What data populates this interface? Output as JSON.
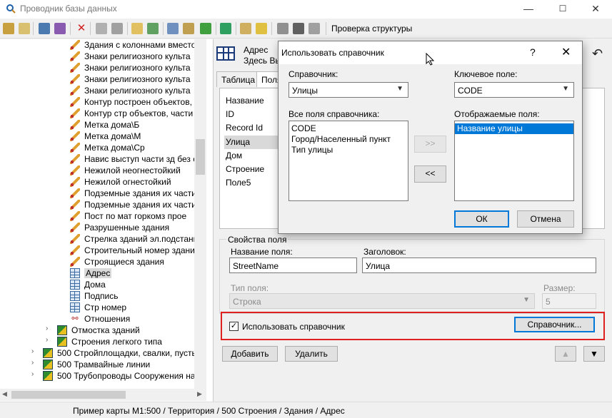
{
  "window": {
    "title": "Проводник базы данных",
    "min": "—",
    "max": "☐",
    "close": "✕"
  },
  "toolbar": {
    "check_structure": "Проверка структуры"
  },
  "tree": {
    "items": [
      {
        "label": "Здания с колоннами вместо",
        "icon": "pencil-icon",
        "indent": 2
      },
      {
        "label": "Знаки религиозного культа",
        "icon": "pencil-icon",
        "indent": 2
      },
      {
        "label": "Знаки религиозного культа",
        "icon": "pencil-icon",
        "indent": 2
      },
      {
        "label": "Знаки религиозного культа",
        "icon": "pencil-icon",
        "indent": 2
      },
      {
        "label": "Знаки религиозного культа",
        "icon": "pencil-icon",
        "indent": 2
      },
      {
        "label": "Контур построен объектов,",
        "icon": "pencil-icon",
        "indent": 2
      },
      {
        "label": "Контур стр объектов, части",
        "icon": "pencil-icon",
        "indent": 2
      },
      {
        "label": "Метка дома\\Б",
        "icon": "pencil-icon",
        "indent": 2
      },
      {
        "label": "Метка дома\\М",
        "icon": "pencil-icon",
        "indent": 2
      },
      {
        "label": "Метка дома\\Ср",
        "icon": "pencil-icon",
        "indent": 2
      },
      {
        "label": "Навис выступ части зд без с",
        "icon": "pencil-icon",
        "indent": 2
      },
      {
        "label": "Нежилой неогнестойкий",
        "icon": "pencil-icon",
        "indent": 2
      },
      {
        "label": "Нежилой огнестойкий",
        "icon": "pencil-icon",
        "indent": 2
      },
      {
        "label": "Подземные здания их части",
        "icon": "pencil-icon",
        "indent": 2
      },
      {
        "label": "Подземные здания их части",
        "icon": "pencil-icon",
        "indent": 2
      },
      {
        "label": "Пост по мат горкомз прое",
        "icon": "pencil-icon",
        "indent": 2
      },
      {
        "label": "Разрушенные здания",
        "icon": "pencil-icon",
        "indent": 2
      },
      {
        "label": "Стрелка зданий эл.подстанц",
        "icon": "pencil-icon",
        "indent": 2
      },
      {
        "label": "Строительный номер здани",
        "icon": "pencil-icon",
        "indent": 2
      },
      {
        "label": "Строящиеся здания",
        "icon": "pencil-icon",
        "indent": 2
      },
      {
        "label": "Адрес",
        "icon": "table-icon",
        "indent": 2,
        "selected": true
      },
      {
        "label": "Дома",
        "icon": "table-icon",
        "indent": 2
      },
      {
        "label": "Подпись",
        "icon": "table-icon",
        "indent": 2
      },
      {
        "label": "Стр номер",
        "icon": "table-icon",
        "indent": 2
      },
      {
        "label": "Отношения",
        "icon": "relation-icon",
        "indent": 2
      },
      {
        "label": "Отмостка зданий",
        "icon": "layer-icon",
        "indent": 1,
        "arrow": "›"
      },
      {
        "label": "Строения легкого типа",
        "icon": "layer-icon",
        "indent": 1,
        "arrow": "›"
      },
      {
        "label": "500 Стройплощадки, свалки, пусть",
        "icon": "layer-icon",
        "indent": 0,
        "arrow": "›"
      },
      {
        "label": "500 Трамвайные линии",
        "icon": "layer-icon",
        "indent": 0,
        "arrow": "›"
      },
      {
        "label": "500 Трубопроводы Сооружения на",
        "icon": "layer-icon",
        "indent": 0,
        "arrow": "›"
      }
    ]
  },
  "panel": {
    "title_line1": "Адрес",
    "title_line2": "Здесь Вы",
    "tabs": [
      "Таблица",
      "Поля"
    ],
    "fields": [
      "Название",
      "ID",
      "Record Id",
      "Улица",
      "Дом",
      "Строение",
      "Поле5"
    ],
    "selected_field": "Улица",
    "props": {
      "legend": "Свойства поля",
      "field_name_label": "Название поля:",
      "field_name_value": "StreetName",
      "caption_label": "Заголовок:",
      "caption_value": "Улица",
      "type_label": "Тип поля:",
      "type_value": "Строка",
      "size_label": "Размер:",
      "size_value": "5"
    },
    "use_dictionary_label": "Использовать справочник",
    "use_dictionary_checked": "✓",
    "dictionary_button": "Справочник...",
    "add_button": "Добавить",
    "delete_button": "Удалить",
    "up_button": "▲",
    "down_button": "▼",
    "undo_icon": "↶"
  },
  "status": {
    "text": "Пример карты М1:500 / Территория / 500 Строения / Здания / Адрес"
  },
  "dialog": {
    "title": "Использовать справочник",
    "help": "?",
    "close": "✕",
    "dictionary_label": "Справочник:",
    "dictionary_value": "Улицы",
    "key_field_label": "Ключевое поле:",
    "key_field_value": "CODE",
    "all_fields_label": "Все поля справочника:",
    "all_fields": [
      "CODE",
      "Город/Населенный пункт",
      "Тип улицы"
    ],
    "display_fields_label": "Отображаемые поля:",
    "display_fields": [
      "Название улицы"
    ],
    "move_right": ">>",
    "move_left": "<<",
    "ok": "ОК",
    "cancel": "Отмена"
  },
  "colors": {
    "accent": "#0078d7",
    "highlight_box": "#e02020",
    "selection": "#0078d7"
  }
}
